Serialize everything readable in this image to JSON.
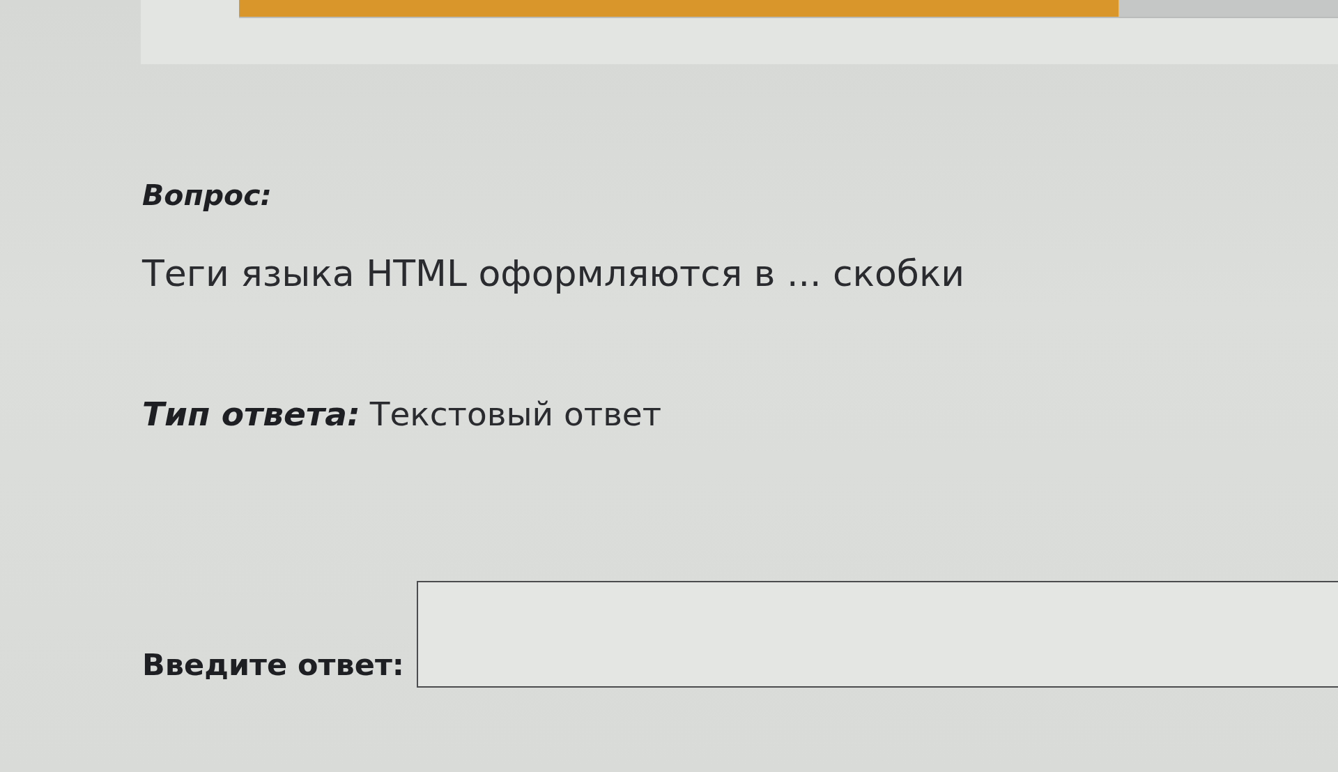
{
  "progress": {
    "level": 0.8
  },
  "question": {
    "label": "Вопрос:",
    "text": "Теги языка HTML оформляются в ... скобки"
  },
  "answer_type": {
    "label": "Тип ответа:",
    "value": "Текстовый ответ"
  },
  "answer": {
    "label": "Введите ответ:"
  }
}
